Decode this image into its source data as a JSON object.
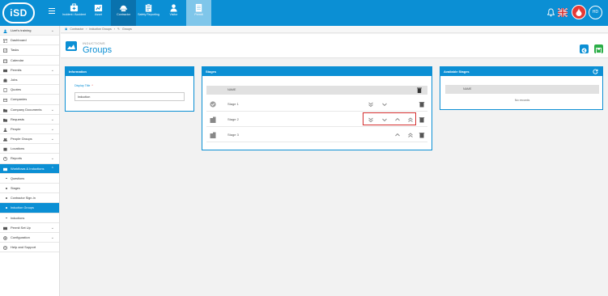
{
  "app": {
    "logo_text": "iSD",
    "colors": {
      "primary": "#0b8fd4",
      "active_tab": "#0a72ad",
      "success": "#2bae47",
      "danger": "#e53935"
    }
  },
  "topnav": {
    "tabs": [
      {
        "label": "Incident / Accident",
        "icon": "first-aid-kit-icon"
      },
      {
        "label": "Asset",
        "icon": "asset-icon"
      },
      {
        "label": "Contractor",
        "icon": "contractor-icon"
      },
      {
        "label": "Safety Reporting",
        "icon": "clipboard-icon"
      },
      {
        "label": "Visitor",
        "icon": "visitor-icon"
      },
      {
        "label": "Permit",
        "icon": "permit-icon"
      }
    ],
    "avatar_initials": "HD"
  },
  "sidebar": {
    "items": [
      {
        "label": "Lizet's training",
        "icon": "user-icon",
        "chevron": true
      },
      {
        "label": "Dashboard",
        "icon": "dashboard-icon"
      },
      {
        "label": "Tasks",
        "icon": "tasks-icon"
      },
      {
        "label": "Calendar",
        "icon": "calendar-icon"
      },
      {
        "label": "Permits",
        "icon": "permit-icon",
        "chevron": true
      },
      {
        "label": "Jobs",
        "icon": "jobs-icon"
      },
      {
        "label": "Quotes",
        "icon": "quotes-icon"
      },
      {
        "label": "Companies",
        "icon": "companies-icon"
      },
      {
        "label": "Company Documents",
        "icon": "documents-icon",
        "chevron": true
      },
      {
        "label": "Requests",
        "icon": "requests-icon",
        "chevron": true
      },
      {
        "label": "People",
        "icon": "people-icon",
        "chevron": true
      },
      {
        "label": "People Groups",
        "icon": "people-groups-icon",
        "chevron": true
      },
      {
        "label": "Locations",
        "icon": "location-icon"
      },
      {
        "label": "Reports",
        "icon": "reports-icon",
        "chevron": true
      },
      {
        "label": "Workflows & Inductions",
        "icon": "workflow-icon",
        "chevron": true
      },
      {
        "label": "Questions"
      },
      {
        "label": "Stages"
      },
      {
        "label": "Contractor Sign-In"
      },
      {
        "label": "Induction Groups"
      },
      {
        "label": "Inductions"
      },
      {
        "label": "Permit Set Up",
        "icon": "permit-setup-icon",
        "chevron": true
      },
      {
        "label": "Configuration",
        "icon": "gear-icon",
        "chevron": true
      },
      {
        "label": "Help and Support",
        "icon": "help-icon"
      }
    ]
  },
  "breadcrumb": {
    "items": [
      "Contractor",
      "Induction Groups",
      "Groups"
    ]
  },
  "header": {
    "subtitle": "INDUCTIONS",
    "title": "Groups"
  },
  "information_panel": {
    "title": "Information",
    "field_label": "Display Title",
    "field_value": "Induction"
  },
  "stages_panel": {
    "title": "Stages",
    "column_header": "NAME",
    "rows": [
      {
        "name": "Stage 1"
      },
      {
        "name": "Stage 2"
      },
      {
        "name": "Stage 3"
      }
    ]
  },
  "available_panel": {
    "title": "Available Stages",
    "column_header": "NAME",
    "empty_text": "No records"
  }
}
